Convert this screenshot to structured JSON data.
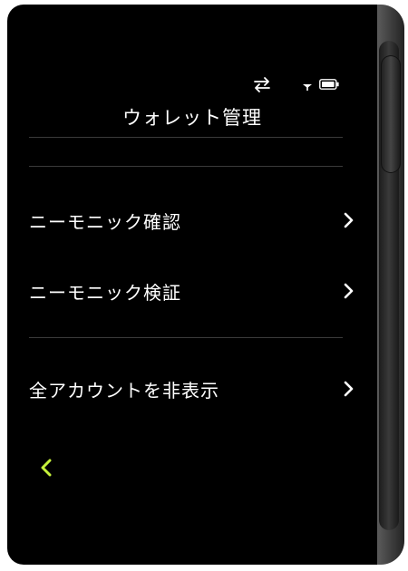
{
  "header": {
    "title": "ウォレット管理"
  },
  "status_bar": {
    "icons": [
      "sync-icon",
      "signal-icon",
      "battery-icon"
    ]
  },
  "menu": {
    "items": [
      {
        "label": "ニーモニック確認",
        "icon": "chevron-right-icon"
      },
      {
        "label": "ニーモニック検証",
        "icon": "chevron-right-icon"
      },
      {
        "label": "全アカウントを非表示",
        "icon": "chevron-right-icon"
      }
    ]
  },
  "navigation": {
    "back_icon": "chevron-left-icon"
  },
  "colors": {
    "background": "#000000",
    "text": "#ffffff",
    "accent": "#c6f23b",
    "divider": "#3a3a3a"
  }
}
